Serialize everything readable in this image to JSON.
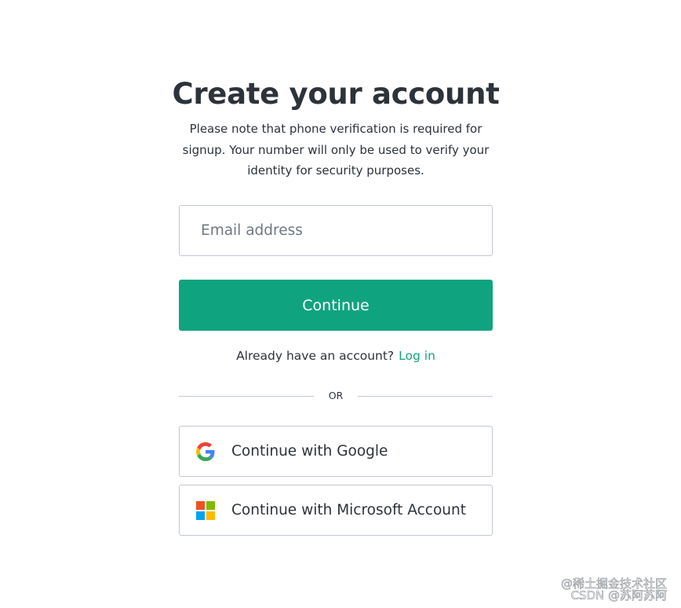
{
  "page": {
    "title": "Create your account",
    "subtitle": "Please note that phone verification is required for signup. Your number will only be used to verify your identity for security purposes."
  },
  "email": {
    "placeholder": "Email address",
    "value": ""
  },
  "continue_button": {
    "label": "Continue"
  },
  "login_prompt": {
    "text": "Already have an account?",
    "link_label": "Log in"
  },
  "divider": {
    "label": "OR"
  },
  "social": {
    "google": {
      "label": "Continue with Google",
      "icon": "google-logo-icon"
    },
    "microsoft": {
      "label": "Continue with Microsoft Account",
      "icon": "microsoft-logo-icon"
    }
  },
  "watermarks": {
    "line1": "@稀土掘金技术社区",
    "line2": "CSDN @苏阿苏阿"
  },
  "colors": {
    "accent": "#10a37f",
    "text": "#2d333a",
    "border": "#c2c8d0",
    "placeholder": "#6f7780"
  }
}
